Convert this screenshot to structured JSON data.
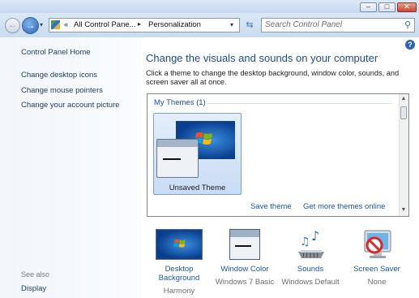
{
  "window": {
    "minimize_glyph": "–",
    "maximize_glyph": "□",
    "close_glyph": "✕"
  },
  "nav": {
    "back_glyph": "←",
    "forward_glyph": "→",
    "address_prefix": "«",
    "breadcrumb": [
      "All Control Pane...",
      "Personalization"
    ],
    "breadcrumb_sep": "▸",
    "search_placeholder": "Search Control Panel"
  },
  "sidebar": {
    "home": "Control Panel Home",
    "links": [
      "Change desktop icons",
      "Change mouse pointers",
      "Change your account picture"
    ],
    "see_also": "See also",
    "see_also_links": [
      "Display"
    ]
  },
  "main": {
    "title": "Change the visuals and sounds on your computer",
    "instructions": "Click a theme to change the desktop background, window color, sounds, and screen saver all at once.",
    "themes_group": "My Themes (1)",
    "selected_theme": "Unsaved Theme",
    "save_theme": "Save theme",
    "get_more": "Get more themes online",
    "bottom_items": [
      {
        "label": "Desktop Background",
        "value": "Harmony",
        "icon": "desktop-background-icon"
      },
      {
        "label": "Window Color",
        "value": "Windows 7 Basic",
        "icon": "window-color-icon"
      },
      {
        "label": "Sounds",
        "value": "Windows Default",
        "icon": "sounds-icon"
      },
      {
        "label": "Screen Saver",
        "value": "None",
        "icon": "screen-saver-icon"
      }
    ]
  },
  "colors": {
    "link": "#1a56a8",
    "title": "#1e4c88",
    "selection": "#c9dcf5"
  }
}
